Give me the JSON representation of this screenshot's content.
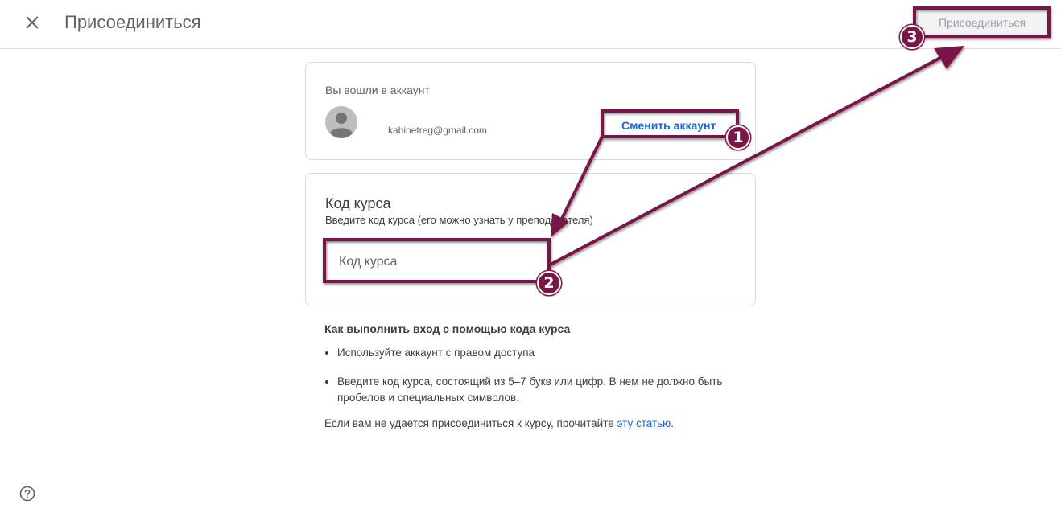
{
  "header": {
    "title": "Присоединиться",
    "join_button": "Присоединиться"
  },
  "account": {
    "label": "Вы вошли в аккаунт",
    "email": "kabinetreg@gmail.com",
    "switch_link": "Сменить аккаунт"
  },
  "course_code": {
    "title": "Код курса",
    "subtitle": "Введите код курса (его можно узнать у преподавателя)",
    "input_placeholder": "Код курса",
    "input_value": ""
  },
  "help": {
    "title": "Как выполнить вход с помощью кода курса",
    "bullets": [
      "Используйте аккаунт с правом доступа",
      "Введите код курса, состоящий из 5–7 букв или цифр. В нем не должно быть пробелов и специальных символов."
    ],
    "footer_text": "Если вам не удается присоединиться к курсу, прочитайте ",
    "footer_link": "эту статью",
    "footer_end": "."
  },
  "annotations": {
    "badges": [
      "1",
      "2",
      "3"
    ],
    "color": "#7a1747"
  },
  "icons": {
    "close": "close-icon",
    "avatar": "account-avatar",
    "help": "help-circle-icon"
  }
}
